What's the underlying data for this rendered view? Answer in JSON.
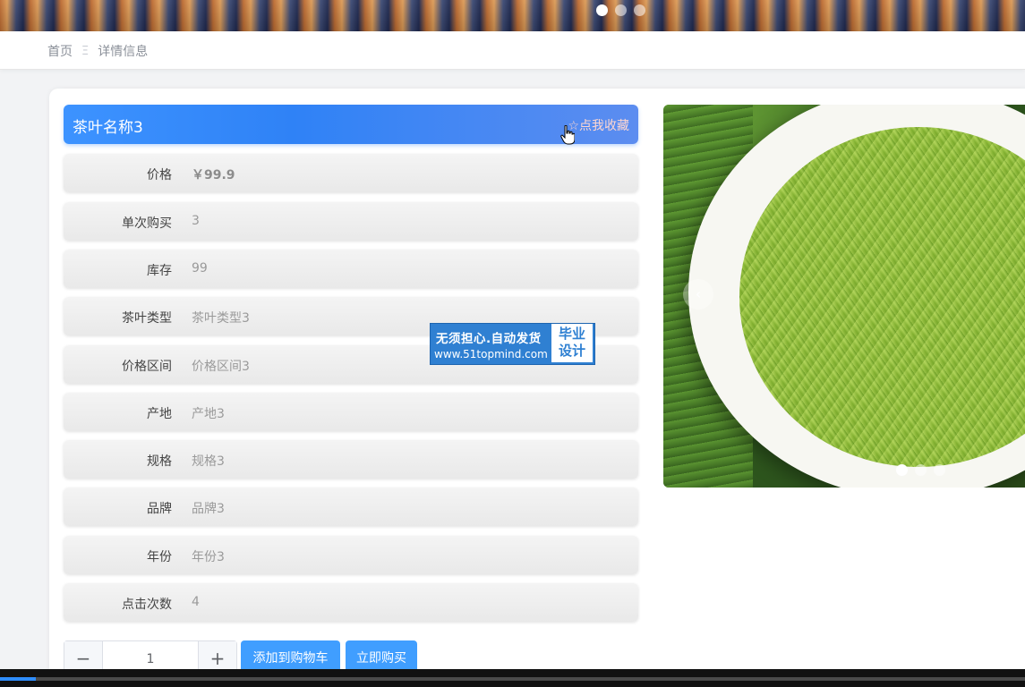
{
  "banner": {
    "dots": 3,
    "active_index": 0
  },
  "breadcrumb": {
    "home": "首页",
    "separator": "Ξ",
    "current": "详情信息"
  },
  "product": {
    "title": "茶叶名称3",
    "favorite_label": "☆点我收藏",
    "rows": [
      {
        "label": "价格",
        "value": "￥99.9"
      },
      {
        "label": "单次购买",
        "value": "3"
      },
      {
        "label": "库存",
        "value": "99"
      },
      {
        "label": "茶叶类型",
        "value": "茶叶类型3"
      },
      {
        "label": "价格区间",
        "value": "价格区间3"
      },
      {
        "label": "产地",
        "value": "产地3"
      },
      {
        "label": "规格",
        "value": "规格3"
      },
      {
        "label": "品牌",
        "value": "品牌3"
      },
      {
        "label": "年份",
        "value": "年份3"
      },
      {
        "label": "点击次数",
        "value": "4"
      }
    ]
  },
  "watermark": {
    "line1": "无须担心.自动发货",
    "line2": "www.51topmind.com",
    "badge1": "毕业",
    "badge2": "设计"
  },
  "actions": {
    "minus": "−",
    "quantity": "1",
    "plus": "+",
    "add_to_cart": "添加到购物车",
    "buy_now": "立即购买"
  },
  "carousel": {
    "prev": "‹",
    "dots": 3,
    "active_index": 0
  },
  "video": {
    "progress": 0.035
  }
}
